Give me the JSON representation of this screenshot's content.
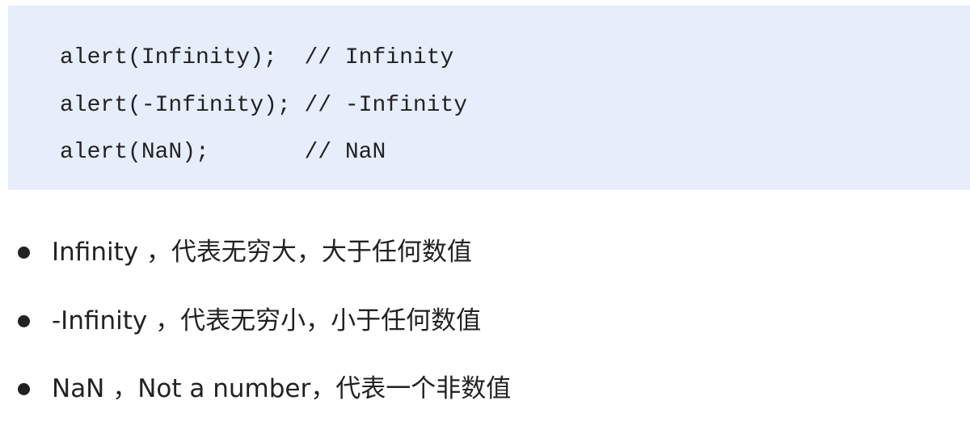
{
  "code": {
    "lines": [
      "alert(Infinity);  // Infinity",
      "alert(-Infinity); // -Infinity",
      "alert(NaN);       // NaN"
    ]
  },
  "bullets": [
    "Infinity ，代表无穷大，大于任何数值",
    "-Infinity ，代表无穷小，小于任何数值",
    "NaN ，Not a number，代表一个非数值"
  ],
  "colors": {
    "code_background": "#e6edfb",
    "text": "#222222"
  }
}
